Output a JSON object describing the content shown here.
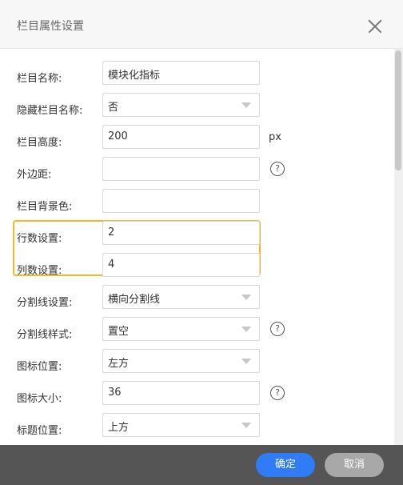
{
  "dialog": {
    "title": "栏目属性设置",
    "confirm_label": "确定",
    "cancel_label": "取消"
  },
  "rows": [
    {
      "label": "栏目名称:",
      "value": "模块化指标",
      "type": "input"
    },
    {
      "label": "隐藏栏目名称:",
      "value": "否",
      "type": "select"
    },
    {
      "label": "栏目高度:",
      "value": "200",
      "type": "input",
      "suffix": "px"
    },
    {
      "label": "外边距:",
      "value": "",
      "type": "input",
      "help": "?"
    },
    {
      "label": "栏目背景色:",
      "value": "",
      "type": "input"
    },
    {
      "label": "行数设置:",
      "value": "2",
      "type": "input"
    },
    {
      "label": "列数设置:",
      "value": "4",
      "type": "input"
    },
    {
      "label": "分割线设置:",
      "value": "横向分割线",
      "type": "select"
    },
    {
      "label": "分割线样式:",
      "value": "置空",
      "type": "select",
      "help": "?"
    },
    {
      "label": "图标位置:",
      "value": "左方",
      "type": "select"
    },
    {
      "label": "图标大小:",
      "value": "36",
      "type": "input",
      "help": "?"
    },
    {
      "label": "标题位置:",
      "value": "上方",
      "type": "select"
    }
  ]
}
